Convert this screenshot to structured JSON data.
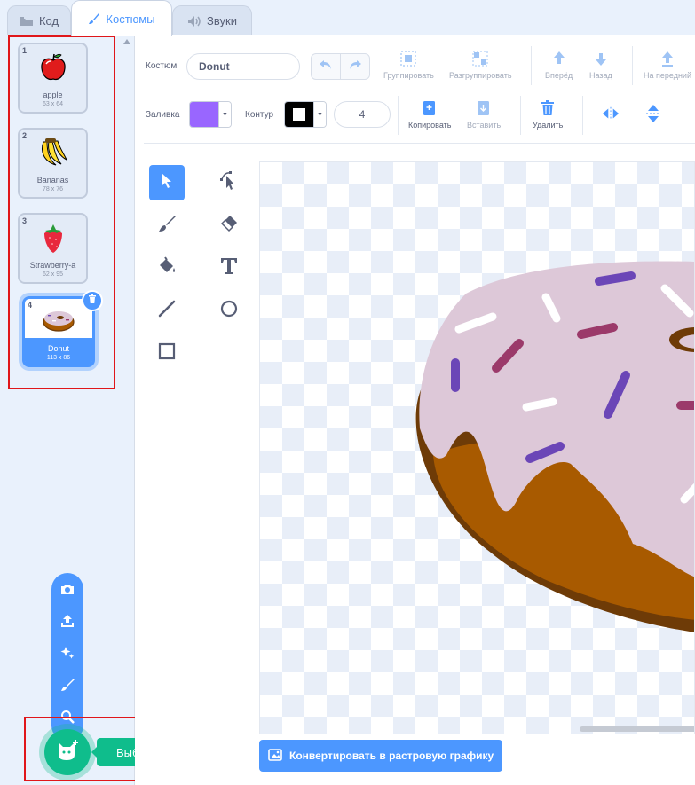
{
  "tabs": [
    {
      "label": "Код",
      "icon": "code-icon"
    },
    {
      "label": "Костюмы",
      "icon": "brush-icon"
    },
    {
      "label": "Звуки",
      "icon": "speaker-icon"
    }
  ],
  "costumes": [
    {
      "num": "1",
      "name": "apple",
      "size": "63 x 64",
      "icon": "apple-icon"
    },
    {
      "num": "2",
      "name": "Bananas",
      "size": "78 x 76",
      "icon": "bananas-icon"
    },
    {
      "num": "3",
      "name": "Strawberry-a",
      "size": "62 x 95",
      "icon": "strawberry-icon"
    },
    {
      "num": "4",
      "name": "Donut",
      "size": "113 x 86",
      "icon": "donut-icon",
      "selected": true
    }
  ],
  "choose_costume": {
    "label": "Выбрать костюм",
    "menu": [
      "camera-icon",
      "upload-icon",
      "surprise-icon",
      "paint-icon",
      "search-icon"
    ]
  },
  "editor": {
    "costume_label": "Костюм",
    "costume_name": "Donut",
    "fill_label": "Заливка",
    "outline_label": "Контур",
    "outline_width": "4",
    "fill_color": "#9966ff",
    "outline_color": "#000000",
    "toolbar": {
      "group": "Группировать",
      "ungroup": "Разгруппировать",
      "forward": "Вперёд",
      "backward": "Назад",
      "front": "На передний",
      "copy": "Копировать",
      "paste": "Вставить",
      "delete": "Удалить"
    },
    "tools": [
      "select-icon",
      "reshape-icon",
      "brush-icon",
      "eraser-icon",
      "fill-icon",
      "text-icon",
      "line-icon",
      "circle-icon",
      "rectangle-icon"
    ],
    "convert_label": "Конвертировать в растровую графику"
  },
  "colors": {
    "accent": "#4c97ff",
    "green": "#0fbd8c",
    "highlight": "#e0161a",
    "frosting": "#ddc8d8",
    "dough": "#a85a00",
    "dough_dark": "#6e3b07"
  }
}
